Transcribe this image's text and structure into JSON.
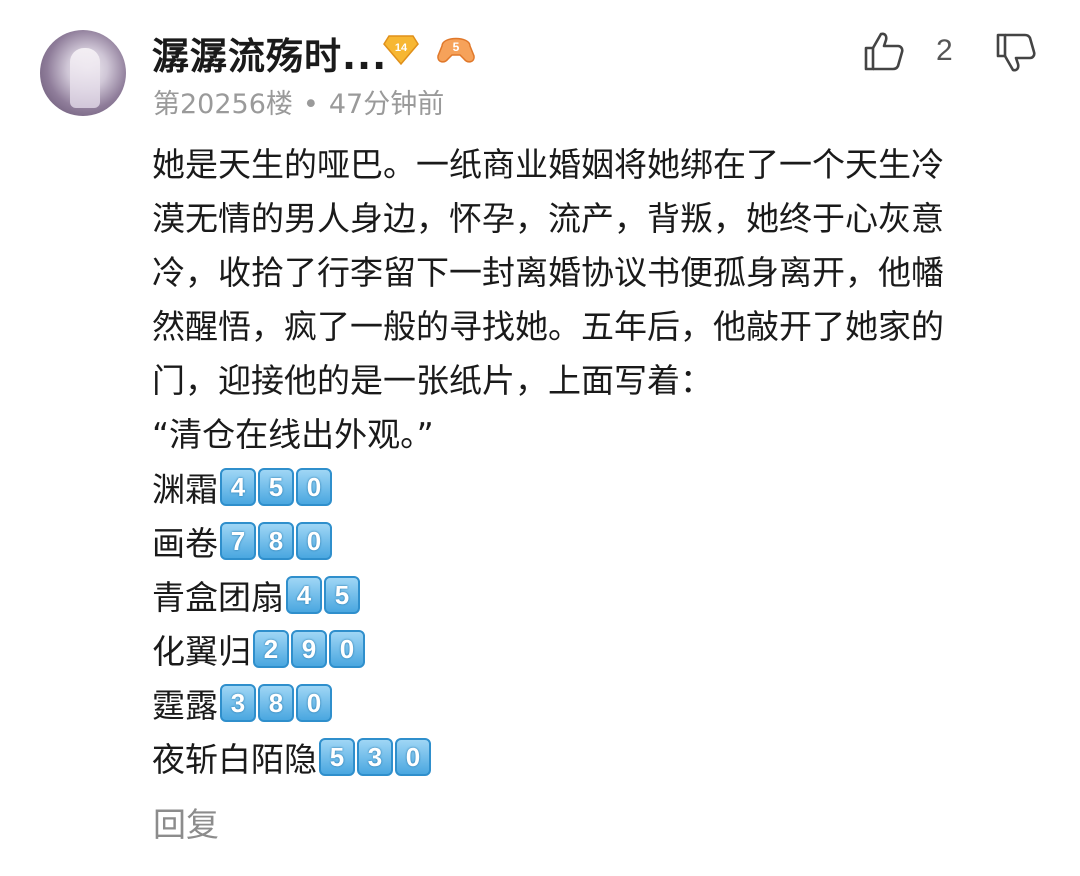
{
  "user": {
    "name": "潺潺流殇时...",
    "level": "14",
    "fan_level": "5",
    "avatar": "avatar-anime-figure"
  },
  "meta": {
    "floor": "第20256楼",
    "separator": "•",
    "time": "47分钟前"
  },
  "actions": {
    "like_icon": "thumbs-up-icon",
    "like_count": "2",
    "dislike_icon": "thumbs-down-icon",
    "reply_label": "回复"
  },
  "content": {
    "lines": [
      "她是天生的哑巴。一纸商业婚姻将她绑在了一个天生冷",
      "漠无情的男人身边，怀孕，流产，背叛，她终于心灰意",
      "冷，收拾了行李留下一封离婚协议书便孤身离开，他幡",
      "然醒悟，疯了一般的寻找她。五年后，他敲开了她家的",
      "门，迎接他的是一张纸片，上面写着：",
      "“清仓在线出外观。”"
    ],
    "items": [
      {
        "name": "渊霜",
        "digits": [
          "4",
          "5",
          "0"
        ]
      },
      {
        "name": "画卷",
        "digits": [
          "7",
          "8",
          "0"
        ]
      },
      {
        "name": "青盒团扇",
        "digits": [
          "4",
          "5"
        ]
      },
      {
        "name": "化翼归",
        "digits": [
          "2",
          "9",
          "0"
        ]
      },
      {
        "name": "霆露",
        "digits": [
          "3",
          "8",
          "0"
        ]
      },
      {
        "name": "夜斩白陌隐",
        "digits": [
          "5",
          "3",
          "0"
        ]
      }
    ]
  },
  "colors": {
    "level_badge": "#f5a623",
    "fan_badge": "#f08a3c",
    "keycap": "#4aa7e0"
  }
}
